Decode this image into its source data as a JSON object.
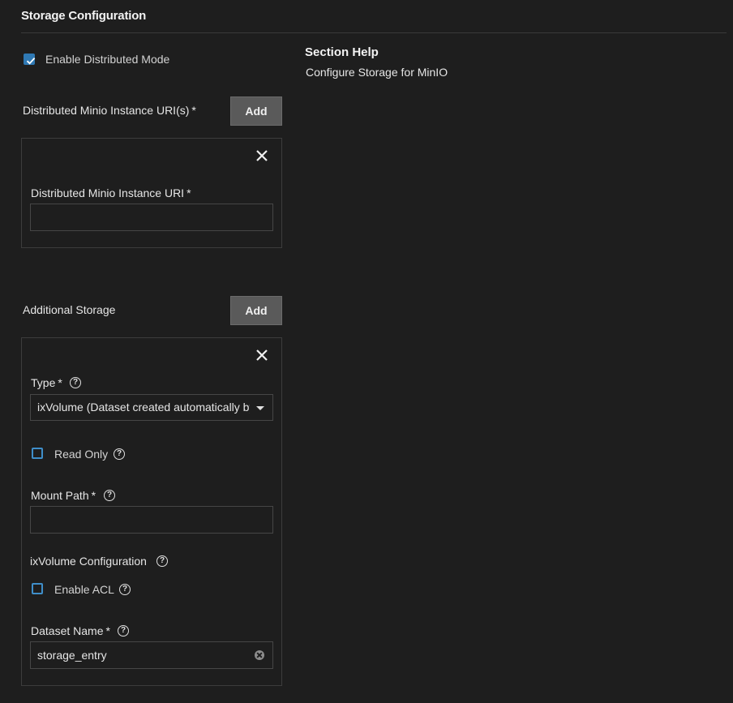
{
  "section": {
    "title": "Storage Configuration"
  },
  "distributed": {
    "enable_label": "Enable Distributed Mode",
    "enabled": true,
    "uris_label": "Distributed Minio Instance URI(s)",
    "add_label": "Add",
    "entry": {
      "uri_label": "Distributed Minio Instance URI",
      "uri_value": ""
    }
  },
  "additional_storage": {
    "label": "Additional Storage",
    "add_label": "Add",
    "entry": {
      "type_label": "Type",
      "type_value": "ixVolume (Dataset created automatically by the system)",
      "read_only_label": "Read Only",
      "read_only": false,
      "mount_path_label": "Mount Path",
      "mount_path_value": "",
      "ix_volume_config_label": "ixVolume Configuration",
      "enable_acl_label": "Enable ACL",
      "enable_acl": false,
      "dataset_name_label": "Dataset Name",
      "dataset_name_value": "storage_entry"
    }
  },
  "help": {
    "title": "Section Help",
    "text": "Configure Storage for MinIO"
  },
  "required_marker": "*",
  "help_glyph": "?",
  "icons": {
    "check": "check-icon",
    "close": "close-icon",
    "help": "help-circle-icon",
    "dropdown": "caret-down-icon",
    "clear": "clear-icon"
  },
  "colors": {
    "background": "#1e1e1e",
    "accent": "#2f79b4",
    "button": "#5a5a5a",
    "border": "#3c3c3c"
  }
}
